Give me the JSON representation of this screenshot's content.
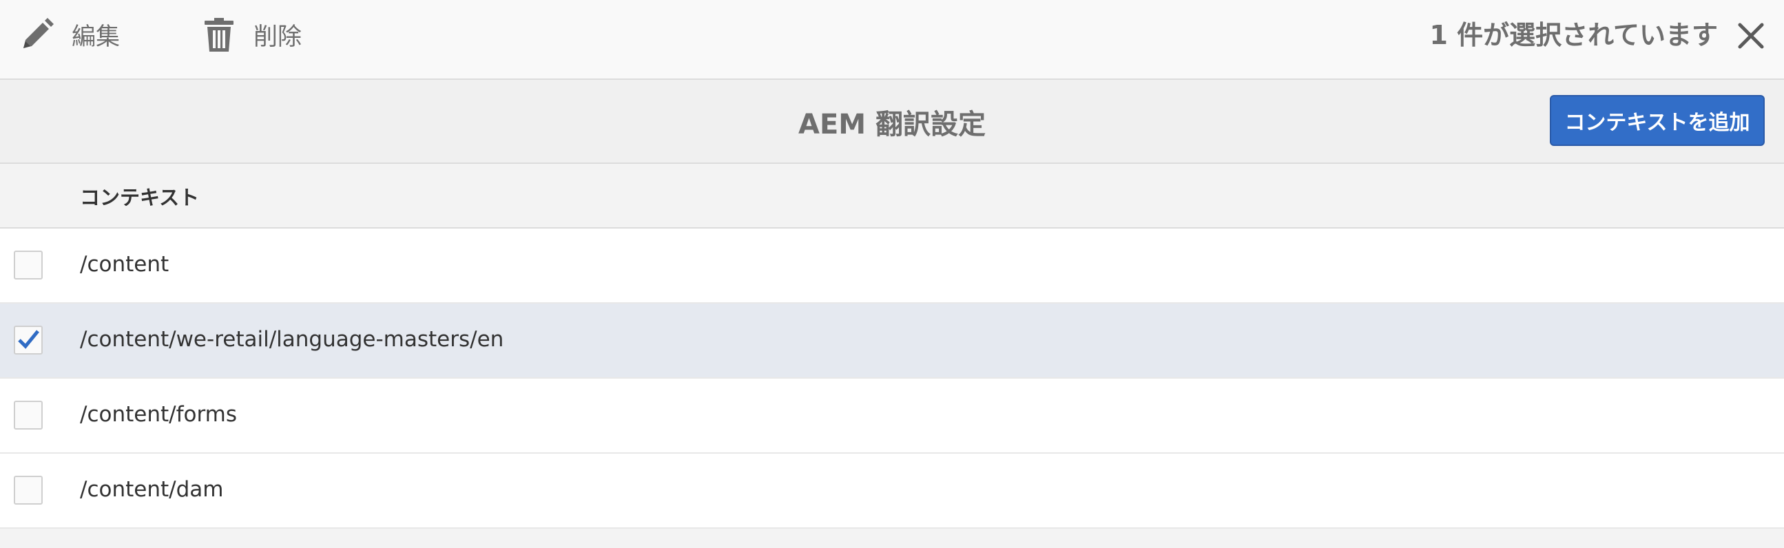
{
  "actionbar": {
    "edit_label": "編集",
    "delete_label": "削除",
    "selection_count": "1 件が選択されています"
  },
  "header": {
    "title": "AEM 翻訳設定",
    "add_context_label": "コンテキストを追加"
  },
  "table": {
    "columns": [
      "コンテキスト"
    ],
    "rows": [
      {
        "path": "/content",
        "selected": false
      },
      {
        "path": "/content/we-retail/language-masters/en",
        "selected": true
      },
      {
        "path": "/content/forms",
        "selected": false
      },
      {
        "path": "/content/dam",
        "selected": false
      }
    ]
  },
  "icons": {
    "edit": "pencil-icon",
    "delete": "trash-icon",
    "close": "close-icon",
    "check": "checkmark-icon"
  },
  "colors": {
    "accent": "#326ec8",
    "selected_row": "#e5e9f0",
    "muted_text": "#6e6e6e"
  }
}
